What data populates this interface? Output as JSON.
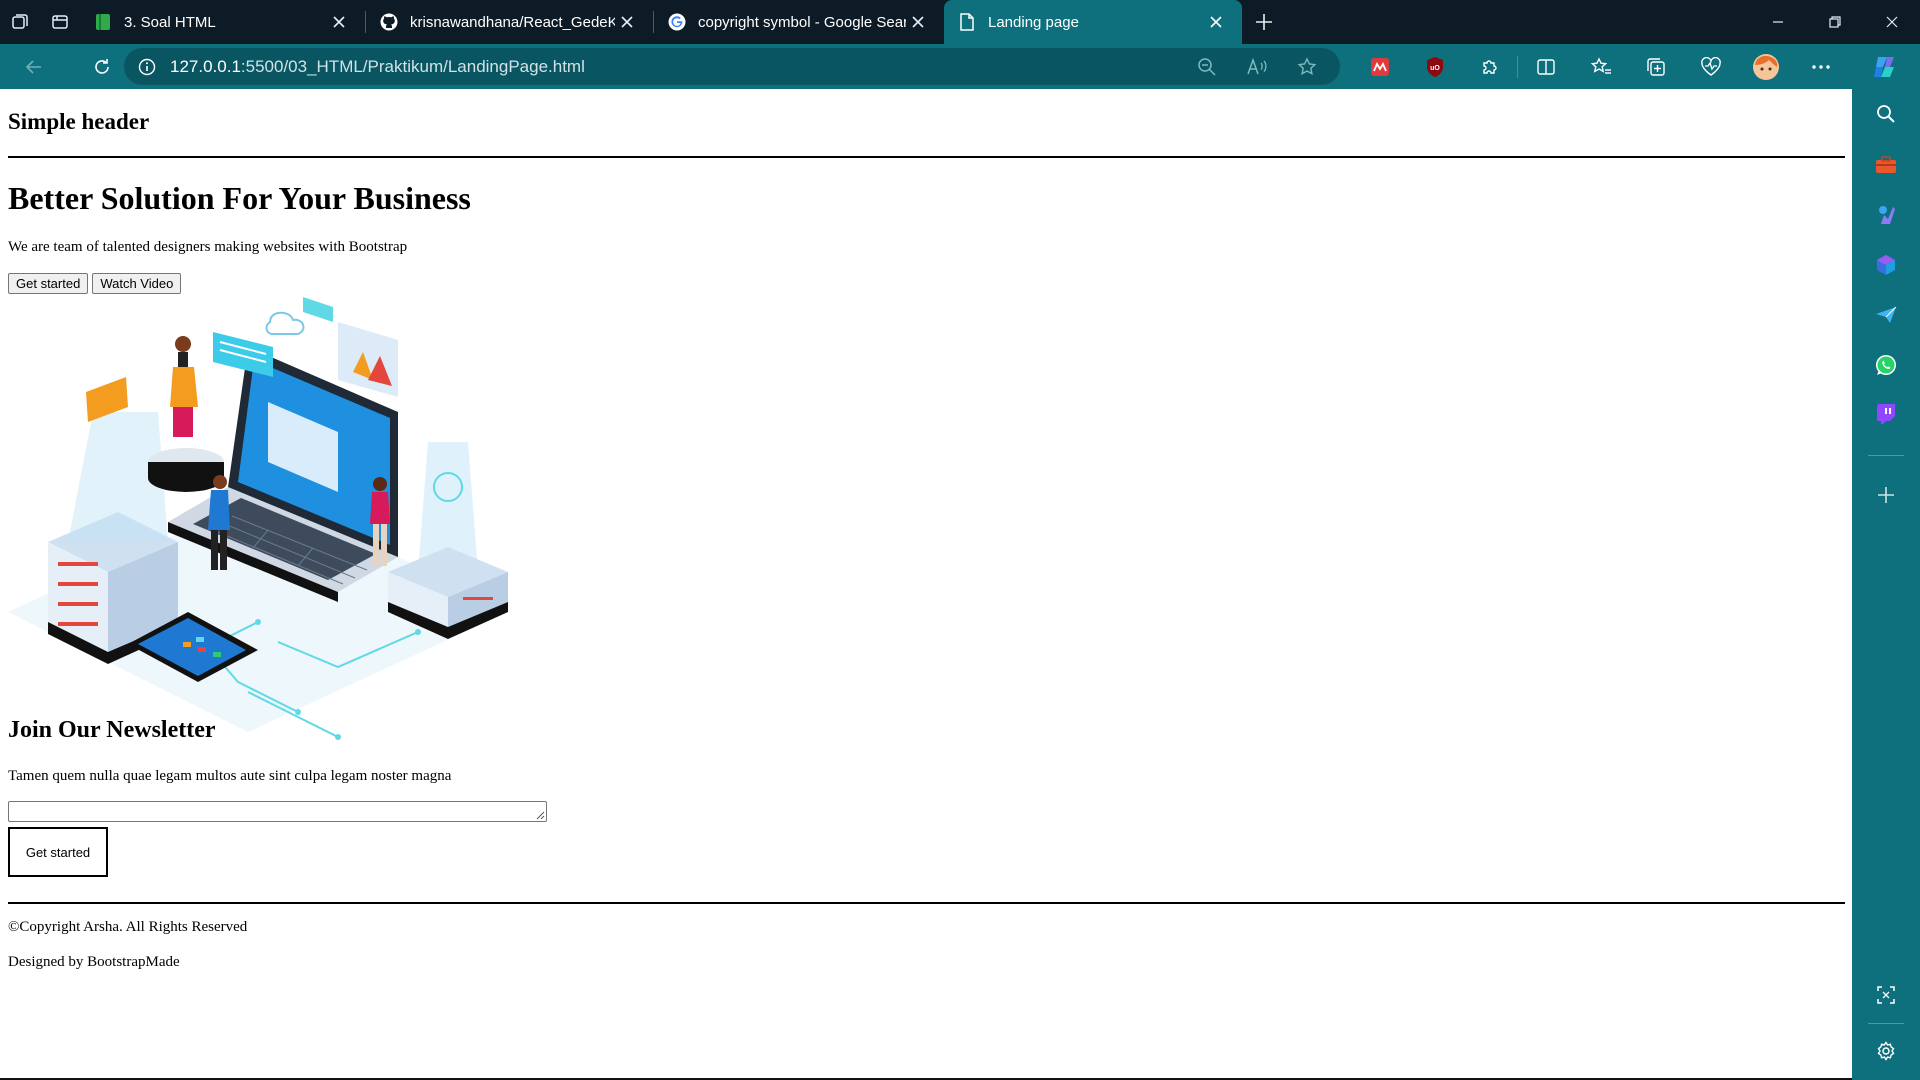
{
  "tabs": [
    {
      "title": "3. Soal HTML",
      "favicon": "green-sheet-icon",
      "active": false
    },
    {
      "title": "krisnawandhana/React_GedeKrisna",
      "favicon": "github-icon",
      "active": false
    },
    {
      "title": "copyright symbol - Google Search",
      "favicon": "google-icon",
      "active": false
    },
    {
      "title": "Landing page",
      "favicon": "page-icon",
      "active": true
    }
  ],
  "address": {
    "host": "127.0.0.1",
    "rest": ":5500/03_HTML/Praktikum/LandingPage.html"
  },
  "page": {
    "header_title": "Simple header",
    "hero_title": "Better Solution For Your Business",
    "hero_text": "We are team of talented designers making websites with Bootstrap",
    "btn_get_started": "Get started",
    "btn_watch_video": "Watch Video",
    "newsletter_title": "Join Our Newsletter",
    "newsletter_text": "Tamen quem nulla quae legam multos aute sint culpa legam noster magna",
    "newsletter_value": "",
    "newsletter_button": "Get started",
    "copyright": "©Copyright Arsha. All Rights Reserved",
    "designed_by": "Designed by BootstrapMade"
  },
  "colors": {
    "tabbar_bg": "#0d1b26",
    "chrome_teal": "#0e6f7d",
    "address_bg": "#0a5562"
  }
}
